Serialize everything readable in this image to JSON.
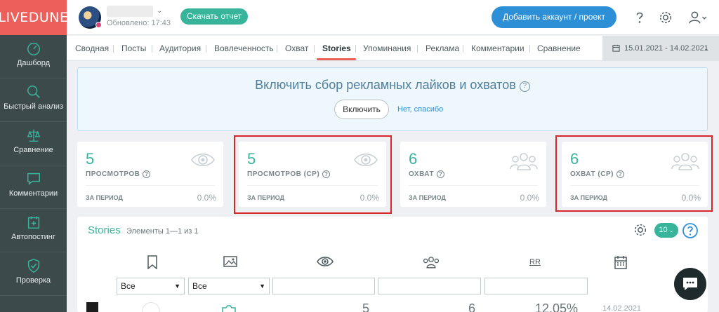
{
  "brand": {
    "logo": "LIVEDUNE"
  },
  "sidebar": {
    "items": [
      {
        "label": "Дашборд",
        "icon": "dashboard-icon"
      },
      {
        "label": "Быстрый анализ",
        "icon": "search-icon"
      },
      {
        "label": "Сравнение",
        "icon": "scales-icon"
      },
      {
        "label": "Комментарии",
        "icon": "comment-icon"
      },
      {
        "label": "Автопостинг",
        "icon": "calendar-plus-icon"
      },
      {
        "label": "Проверка",
        "icon": "shield-check-icon"
      }
    ]
  },
  "topbar": {
    "updated": "Обновлено: 17:43",
    "report_button": "Скачать отчет",
    "add_button": "Добавить аккаунт / проект"
  },
  "tabs": [
    {
      "label": "Сводная"
    },
    {
      "label": "Посты"
    },
    {
      "label": "Аудитория"
    },
    {
      "label": "Вовлеченность"
    },
    {
      "label": "Охват"
    },
    {
      "label": "Stories",
      "active": true
    },
    {
      "label": "Упоминания"
    },
    {
      "label": "Реклама"
    },
    {
      "label": "Комментарии"
    },
    {
      "label": "Сравнение"
    }
  ],
  "date_range": "15.01.2021 - 14.02.2021",
  "banner": {
    "title": "Включить сбор рекламных лайков и охватов",
    "enable_button": "Включить",
    "dismiss_link": "Нет, спасибо"
  },
  "cards": [
    {
      "value": "5",
      "label": "ПРОСМОТРОВ",
      "period": "ЗА ПЕРИОД",
      "change": "0.0%",
      "icon": "eye-icon",
      "highlighted": false
    },
    {
      "value": "5",
      "label": "ПРОСМОТРОВ (СР)",
      "period": "ЗА ПЕРИОД",
      "change": "0.0%",
      "icon": "eye-icon",
      "highlighted": true
    },
    {
      "value": "6",
      "label": "ОХВАТ",
      "period": "ЗА ПЕРИОД",
      "change": "0.0%",
      "icon": "people-icon",
      "highlighted": false
    },
    {
      "value": "6",
      "label": "ОХВАТ (СР)",
      "period": "ЗА ПЕРИОД",
      "change": "0.0%",
      "icon": "people-icon",
      "highlighted": true
    }
  ],
  "stories": {
    "title": "Stories",
    "subtitle": "Элементы 1—1 из 1",
    "per_page": "10",
    "rr_label": "RR",
    "filter_type": "Все",
    "filter_media": "Все",
    "row": {
      "views": "5",
      "reach": "6",
      "rr": "12.05%",
      "date": "14.02.2021"
    }
  },
  "colors": {
    "brand": "#ec5f5b",
    "sidebar": "#3d4a4c",
    "accent": "#38b49a",
    "primary": "#2d8fd5",
    "highlight": "#d7262b"
  }
}
